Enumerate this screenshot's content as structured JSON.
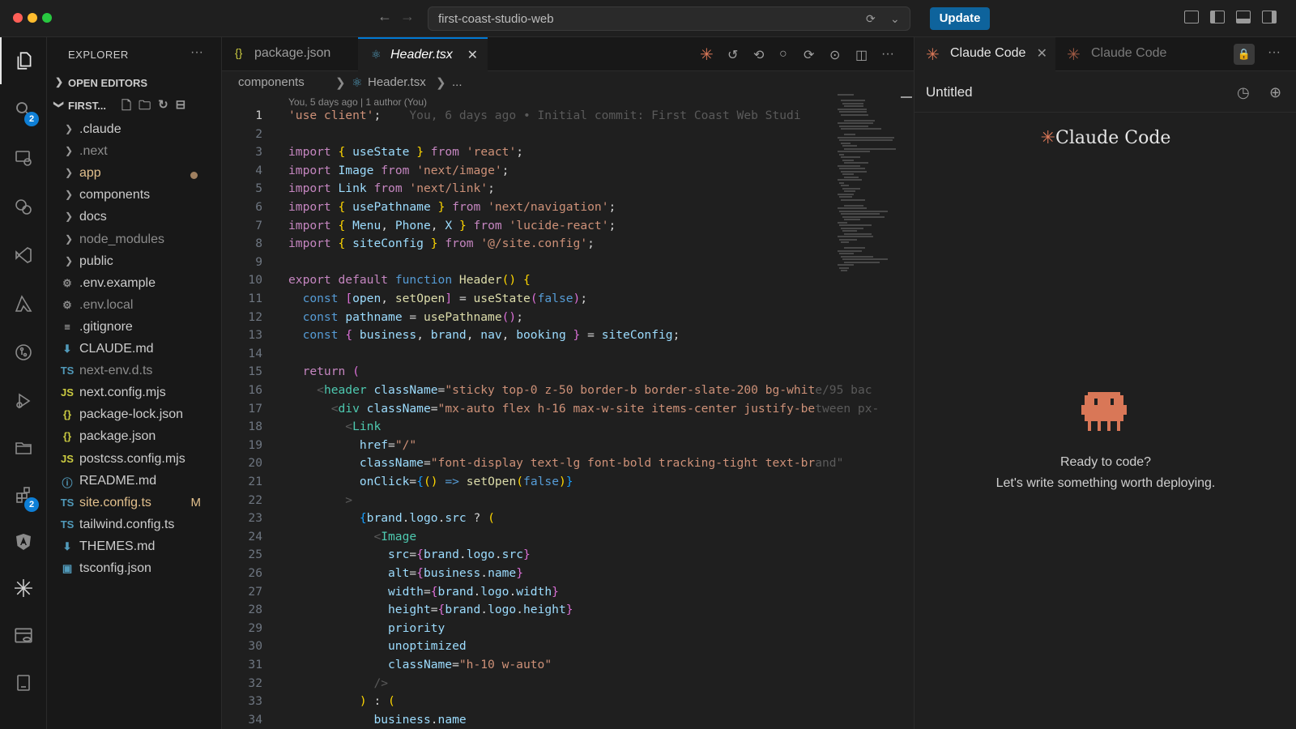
{
  "window": {
    "title": "first-coast-studio-web",
    "update_label": "Update"
  },
  "colors": {
    "accent": "#0078d4",
    "update_button": "#0e639c",
    "claude_orange": "#d97757",
    "modified": "#e2c08d"
  },
  "activity_bar": {
    "items": [
      {
        "name": "explorer",
        "icon": "files-icon"
      },
      {
        "name": "search",
        "icon": "search-icon",
        "badge": "2"
      },
      {
        "name": "remote",
        "icon": "remote-explorer-icon"
      },
      {
        "name": "timeline",
        "icon": "timeline-icon"
      },
      {
        "name": "visual-studio",
        "icon": "vs-icon"
      },
      {
        "name": "azure",
        "icon": "azure-icon"
      },
      {
        "name": "source-control",
        "icon": "git-icon"
      },
      {
        "name": "run-debug",
        "icon": "debug-icon"
      },
      {
        "name": "folder",
        "icon": "folder-icon"
      },
      {
        "name": "extensions",
        "icon": "extensions-icon",
        "badge": "2"
      },
      {
        "name": "angular",
        "icon": "angular-icon"
      },
      {
        "name": "claude",
        "icon": "claude-spark-icon"
      },
      {
        "name": "database",
        "icon": "database-icon"
      },
      {
        "name": "notebook",
        "icon": "notebook-icon"
      }
    ]
  },
  "sidebar": {
    "title": "EXPLORER",
    "open_editors_label": "OPEN EDITORS",
    "folder_label": "FIRST...",
    "items": [
      {
        "name": ".claude",
        "type": "folder"
      },
      {
        "name": ".next",
        "type": "folder",
        "dim": true
      },
      {
        "name": "app",
        "type": "folder",
        "modified": true
      },
      {
        "name": "components",
        "type": "folder"
      },
      {
        "name": "docs",
        "type": "folder"
      },
      {
        "name": "node_modules",
        "type": "folder",
        "dim": true
      },
      {
        "name": "public",
        "type": "folder"
      },
      {
        "name": ".env.example",
        "type": "gear"
      },
      {
        "name": ".env.local",
        "type": "gear",
        "dim": true
      },
      {
        "name": ".gitignore",
        "type": "lines"
      },
      {
        "name": "CLAUDE.md",
        "type": "md"
      },
      {
        "name": "next-env.d.ts",
        "type": "ts",
        "dim": true
      },
      {
        "name": "next.config.mjs",
        "type": "js"
      },
      {
        "name": "package-lock.json",
        "type": "json"
      },
      {
        "name": "package.json",
        "type": "json"
      },
      {
        "name": "postcss.config.mjs",
        "type": "js"
      },
      {
        "name": "README.md",
        "type": "info"
      },
      {
        "name": "site.config.ts",
        "type": "ts",
        "modified": true,
        "mark": "M"
      },
      {
        "name": "tailwind.config.ts",
        "type": "ts"
      },
      {
        "name": "THEMES.md",
        "type": "md"
      },
      {
        "name": "tsconfig.json",
        "type": "tsconfig"
      }
    ]
  },
  "editor": {
    "tabs": [
      {
        "label": "package.json",
        "icon": "{}"
      },
      {
        "label": "Header.tsx",
        "icon": "⚛"
      }
    ],
    "breadcrumbs": [
      "components",
      "Header.tsx",
      "..."
    ],
    "blame_header": "You, 5 days ago | 1 author (You)",
    "inline_blame": "You, 6 days ago • Initial commit: First Coast Web Studi",
    "line_numbers": [
      "1",
      "2",
      "3",
      "4",
      "5",
      "6",
      "7",
      "8",
      "9",
      "10",
      "11",
      "12",
      "13",
      "14",
      "15",
      "16",
      "17",
      "18",
      "19",
      "20",
      "21",
      "22",
      "23",
      "24",
      "25",
      "26",
      "27",
      "28",
      "29",
      "30",
      "31",
      "32",
      "33",
      "34"
    ]
  },
  "panel": {
    "tabs": [
      "Claude Code",
      "Claude Code"
    ],
    "title": "Untitled",
    "brand": "Claude Code",
    "ready_line1": "Ready to code?",
    "ready_line2": "Let's write something worth deploying."
  }
}
